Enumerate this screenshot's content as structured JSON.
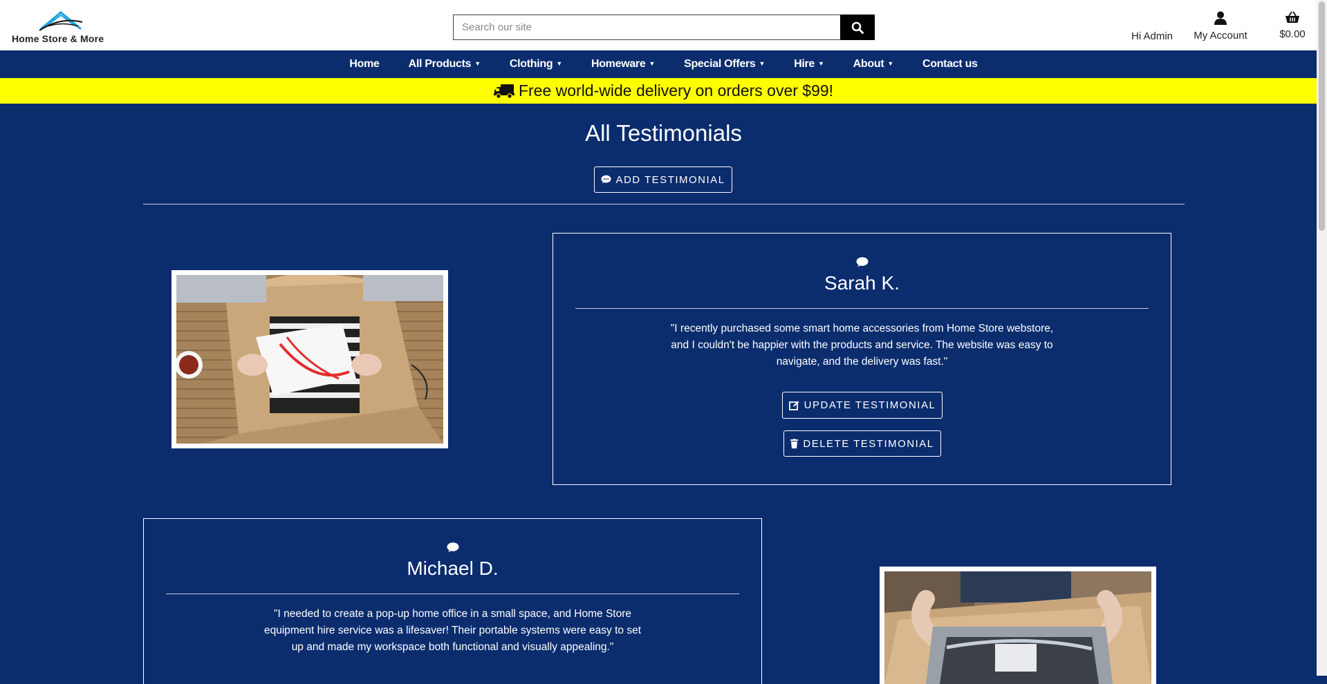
{
  "header": {
    "logo_text": "Home Store & More",
    "search_placeholder": "Search our site",
    "greeting": "Hi Admin",
    "account_label": "My Account",
    "cart_total": "$0.00"
  },
  "nav": {
    "items": [
      {
        "label": "Home",
        "dropdown": false
      },
      {
        "label": "All Products",
        "dropdown": true
      },
      {
        "label": "Clothing",
        "dropdown": true
      },
      {
        "label": "Homeware",
        "dropdown": true
      },
      {
        "label": "Special Offers",
        "dropdown": true
      },
      {
        "label": "Hire",
        "dropdown": true
      },
      {
        "label": "About",
        "dropdown": true
      },
      {
        "label": "Contact us",
        "dropdown": false
      }
    ]
  },
  "promo": {
    "text": "Free world-wide delivery on orders over $99!"
  },
  "main": {
    "title": "All Testimonials",
    "add_button": "ADD TESTIMONIAL"
  },
  "testimonials": [
    {
      "name": "Sarah K.",
      "quote": "\"I recently purchased some smart home accessories from Home Store webstore, and I couldn't be happier with the products and service. The website was easy to navigate, and the delivery was fast.\"",
      "update_label": "UPDATE TESTIMONIAL",
      "delete_label": "DELETE TESTIMONIAL",
      "image_icon": "unboxing-clothes-photo"
    },
    {
      "name": "Michael D.",
      "quote": "\"I needed to create a pop-up home office in a small space, and Home Store equipment hire service was a lifesaver! Their portable systems were easy to set up and made my workspace both functional and visually appealing.\"",
      "image_icon": "unboxing-package-photo"
    }
  ],
  "colors": {
    "page_bg": "#0b2d6e",
    "promo_bg": "#ffff00",
    "logo_accent": "#1aa3e0"
  }
}
